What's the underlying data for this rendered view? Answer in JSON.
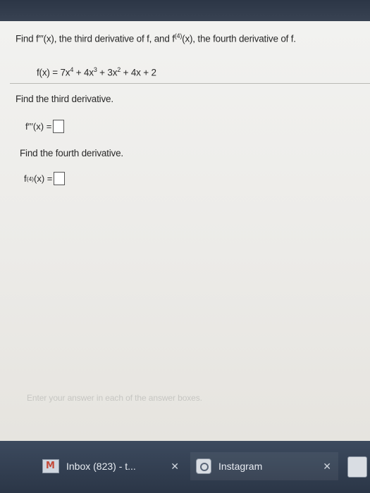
{
  "question": {
    "prefix": "Find f′′′(x), the third derivative of f, and f",
    "sup": "(4)",
    "suffix": "(x), the fourth derivative of f."
  },
  "function": {
    "lhs": "f(x) = 7x",
    "e1": "4",
    "t2": " + 4x",
    "e2": "3",
    "t3": " + 3x",
    "e3": "2",
    "t4": " + 4x + 2"
  },
  "third": {
    "title": "Find the third derivative.",
    "label": "f′′′(x) ="
  },
  "fourth": {
    "title": "Find the fourth derivative.",
    "label_f": "f",
    "label_sup": "(4)",
    "label_rest": "(x) ="
  },
  "hint": "Enter your answer in each of the answer boxes.",
  "taskbar": {
    "inbox_label": "Inbox (823) - t...",
    "inbox_close": "✕",
    "insta_label": "Instagram",
    "insta_close": "✕"
  }
}
